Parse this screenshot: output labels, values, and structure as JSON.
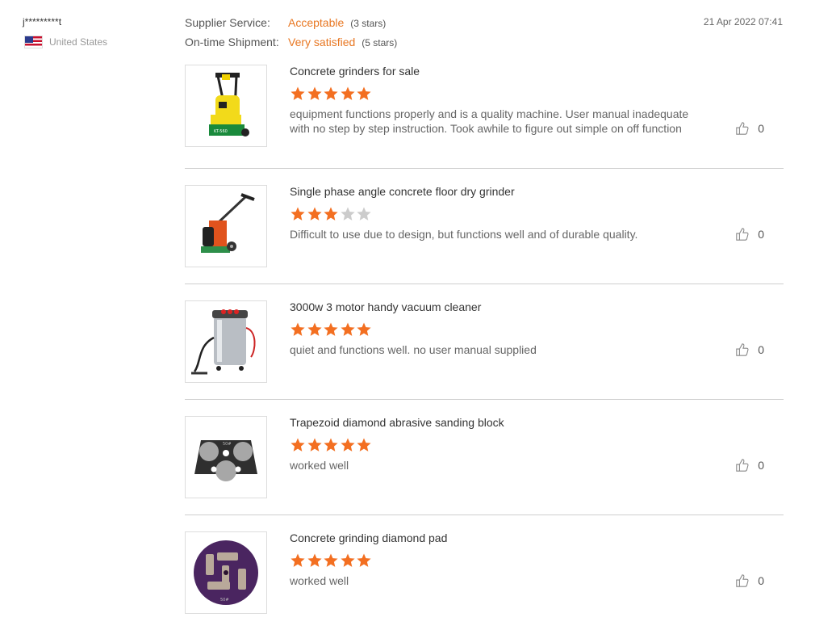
{
  "reviewer": {
    "name": "j*********t",
    "country": "United States",
    "flag_icon": "us-flag-icon"
  },
  "ratings": {
    "supplier_service": {
      "label": "Supplier Service:",
      "value": "Acceptable",
      "stars": "(3 stars)"
    },
    "shipment": {
      "label": "On-time Shipment:",
      "value": "Very satisfied",
      "stars": "(5 stars)"
    }
  },
  "date": "21 Apr 2022 07:41",
  "colors": {
    "accent": "#e87722",
    "star_on": "#f36f21",
    "star_off": "#cccccc"
  },
  "items": [
    {
      "title": "Concrete grinders for sale",
      "rating": 5,
      "text": "equipment functions properly and is a quality machine.  User manual inadequate with no step by step instruction. Took awhile to figure out simple on off function",
      "likes": "0",
      "image": "yellow-floor-grinder"
    },
    {
      "title": "Single phase angle concrete floor dry grinder",
      "rating": 3,
      "text": "Difficult to use due to design, but functions well and of durable quality.",
      "likes": "0",
      "image": "orange-angle-grinder"
    },
    {
      "title": "3000w 3 motor handy vacuum cleaner",
      "rating": 5,
      "text": "quiet and functions well. no user manual supplied",
      "likes": "0",
      "image": "steel-vacuum-cleaner"
    },
    {
      "title": "Trapezoid diamond abrasive sanding block",
      "rating": 5,
      "text": "worked well",
      "likes": "0",
      "image": "trapezoid-sanding-block"
    },
    {
      "title": "Concrete grinding diamond pad",
      "rating": 5,
      "text": "worked well",
      "likes": "0",
      "image": "purple-diamond-pad"
    }
  ]
}
